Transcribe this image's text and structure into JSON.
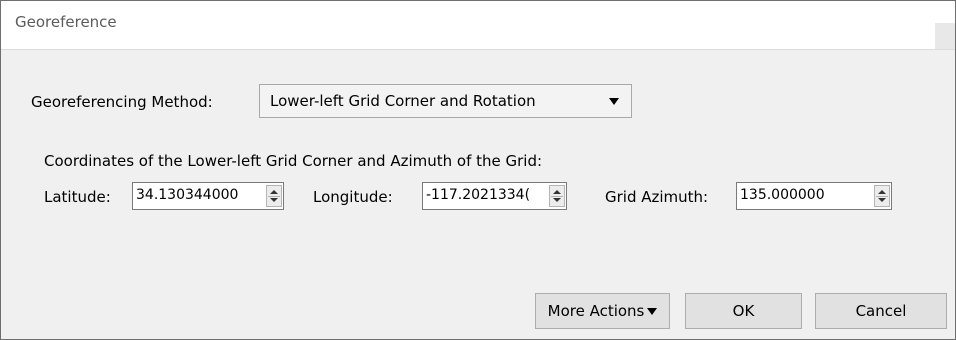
{
  "window": {
    "title": "Georeference"
  },
  "method": {
    "label": "Georeferencing Method:",
    "selected": "Lower-left Grid Corner and Rotation"
  },
  "coords": {
    "heading": "Coordinates of the Lower-left Grid Corner and Azimuth of the Grid:",
    "latitude_label": "Latitude:",
    "latitude_value": "34.130344000",
    "longitude_label": "Longitude:",
    "longitude_value": "-117.2021334(",
    "azimuth_label": "Grid Azimuth:",
    "azimuth_value": "135.000000"
  },
  "buttons": {
    "more_actions": "More Actions",
    "ok": "OK",
    "cancel": "Cancel"
  },
  "colors": {
    "window_bg": "#f0f0f0",
    "button_bg": "#e1e1e1",
    "title_text": "#5b5b5b"
  }
}
